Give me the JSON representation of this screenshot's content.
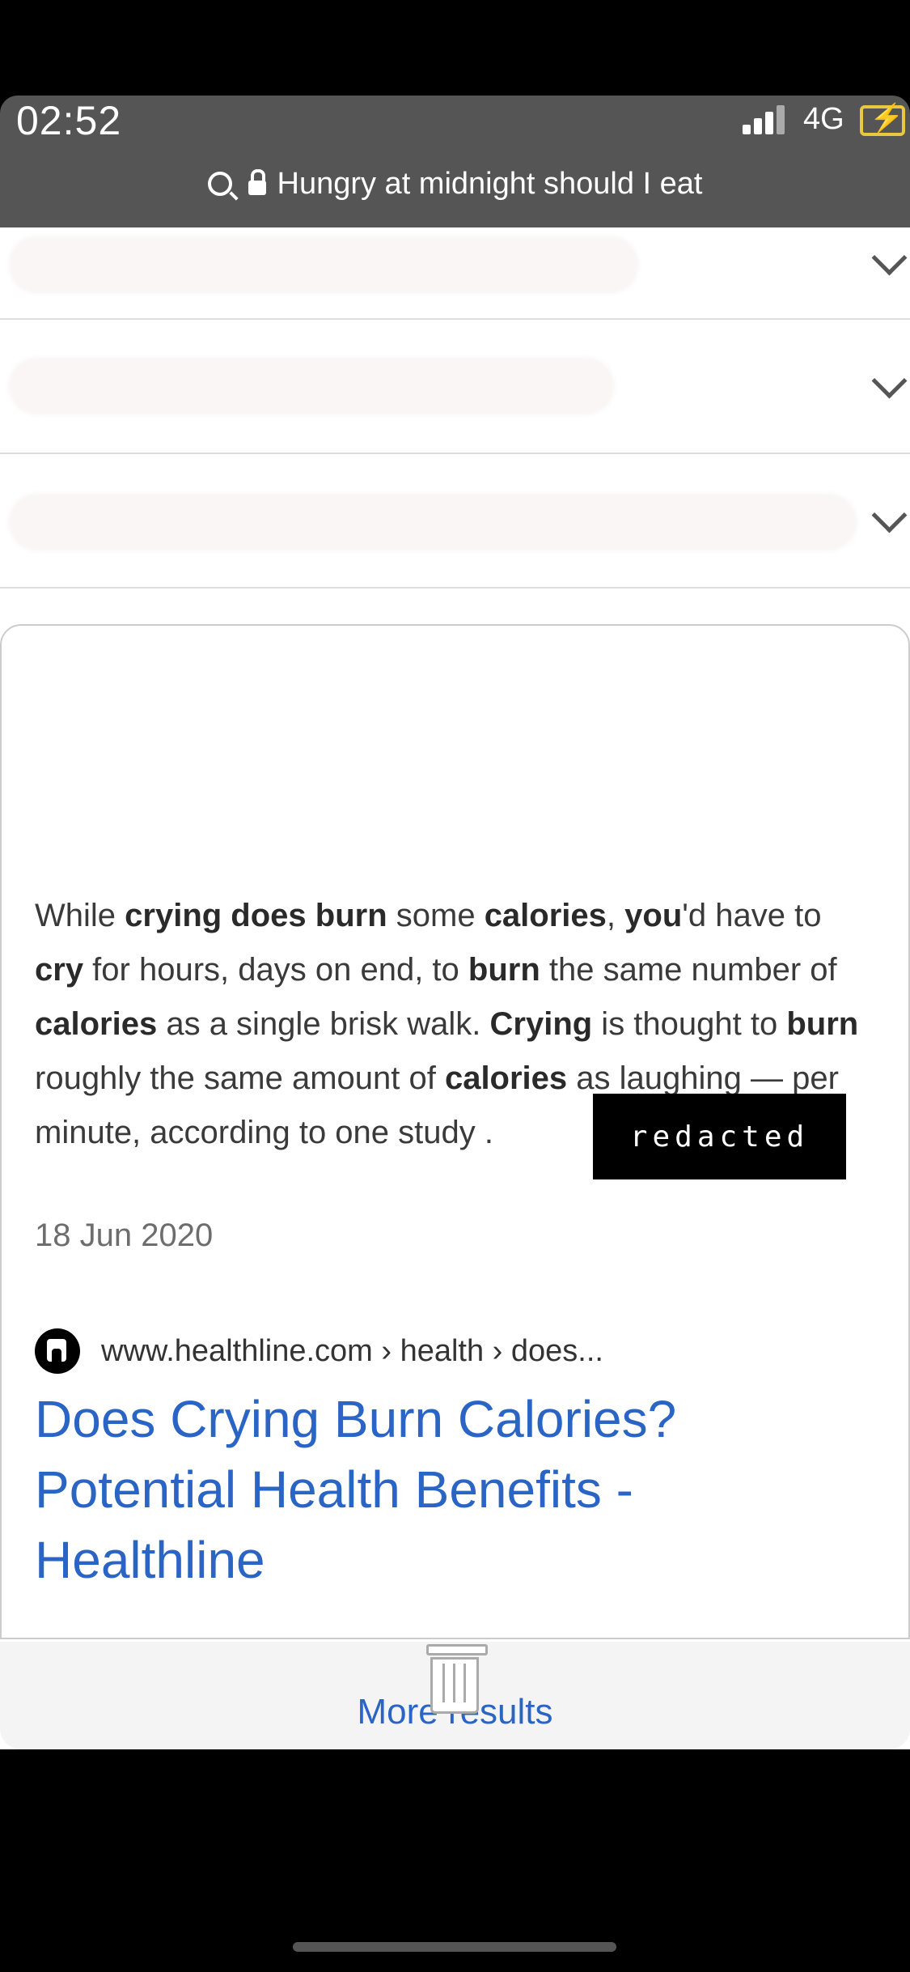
{
  "status_bar": {
    "time": "02:52",
    "network": "4G"
  },
  "url_bar": {
    "query": "Hungry at midnight should I eat"
  },
  "accordion": [
    {
      "expanded": false
    },
    {
      "expanded": false
    },
    {
      "expanded": false
    },
    {
      "expanded": false
    },
    {
      "expanded": true
    }
  ],
  "answer": {
    "segments": [
      {
        "t": "While ",
        "b": false
      },
      {
        "t": "crying does burn",
        "b": true
      },
      {
        "t": " some ",
        "b": false
      },
      {
        "t": "calories",
        "b": true
      },
      {
        "t": ", ",
        "b": false
      },
      {
        "t": "you",
        "b": true
      },
      {
        "t": "'d have to ",
        "b": false
      },
      {
        "t": "cry",
        "b": true
      },
      {
        "t": " for hours, days on end, to ",
        "b": false
      },
      {
        "t": "burn",
        "b": true
      },
      {
        "t": " the same number of ",
        "b": false
      },
      {
        "t": "calories",
        "b": true
      },
      {
        "t": " as a single brisk walk. ",
        "b": false
      },
      {
        "t": "Crying",
        "b": true
      },
      {
        "t": " is thought to ",
        "b": false
      },
      {
        "t": "burn",
        "b": true
      },
      {
        "t": " roughly the same amount of ",
        "b": false
      },
      {
        "t": "calories",
        "b": true
      },
      {
        "t": " as laughing — ",
        "b": false
      },
      {
        "t": "per minute, according to one study .",
        "b": false
      }
    ],
    "date": "18 Jun 2020",
    "redacted_label": "redacted"
  },
  "source": {
    "breadcrumb": "www.healthline.com › health › does...",
    "title": "Does Crying Burn Calories? Potential Health Benefits - Healthline"
  },
  "more_results": "More results"
}
